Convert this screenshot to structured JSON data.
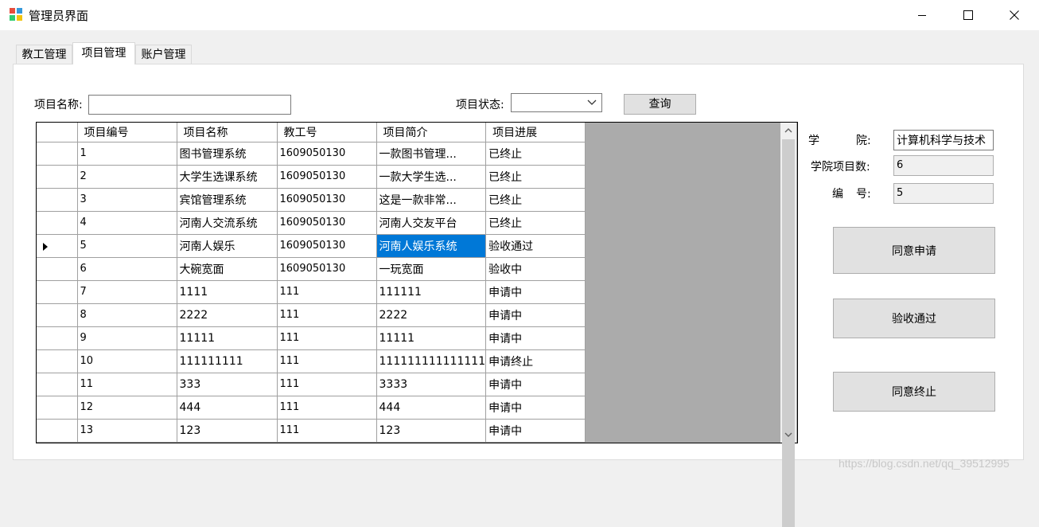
{
  "window": {
    "title": "管理员界面",
    "minimize_icon": "minimize-icon",
    "maximize_icon": "maximize-icon",
    "close_icon": "close-icon"
  },
  "tabs": [
    {
      "label": "教工管理",
      "selected": false
    },
    {
      "label": "项目管理",
      "selected": true
    },
    {
      "label": "账户管理",
      "selected": false
    }
  ],
  "search": {
    "name_label": "项目名称:",
    "name_value": "",
    "status_label": "项目状态:",
    "status_value": "",
    "query_label": "查询"
  },
  "grid": {
    "columns": [
      "项目编号",
      "项目名称",
      "教工号",
      "项目简介",
      "项目进展"
    ],
    "current_row": 5,
    "selected_cell": "项目简介",
    "rows": [
      [
        "1",
        "图书管理系统",
        "1609050130",
        "一款图书管理...",
        "已终止"
      ],
      [
        "2",
        "大学生选课系统",
        "1609050130",
        "一款大学生选...",
        "已终止"
      ],
      [
        "3",
        "宾馆管理系统",
        "1609050130",
        "这是一款非常...",
        "已终止"
      ],
      [
        "4",
        "河南人交流系统",
        "1609050130",
        "河南人交友平台",
        "已终止"
      ],
      [
        "5",
        "河南人娱乐",
        "1609050130",
        "河南人娱乐系统",
        "验收通过"
      ],
      [
        "6",
        "大碗宽面",
        "1609050130",
        "一玩宽面",
        "验收中"
      ],
      [
        "7",
        "1111",
        "111",
        "111111",
        "申请中"
      ],
      [
        "8",
        "2222",
        "111",
        "2222",
        "申请中"
      ],
      [
        "9",
        "11111",
        "111",
        "11111",
        "申请中"
      ],
      [
        "10",
        "111111111",
        "111",
        "111111111111111",
        "申请终止"
      ],
      [
        "11",
        "333",
        "111",
        "3333",
        "申请中"
      ],
      [
        "12",
        "444",
        "111",
        "444",
        "申请中"
      ],
      [
        "13",
        "123",
        "111",
        "123",
        "申请中"
      ]
    ]
  },
  "details": {
    "college_label_a": "学",
    "college_label_b": "院:",
    "college_value": "计算机科学与技术",
    "count_label": "学院项目数:",
    "count_value": "6",
    "number_label_a": "编",
    "number_label_b": "号:",
    "number_value": "5"
  },
  "actions": {
    "approve": "同意申请",
    "accept": "验收通过",
    "terminate": "同意终止"
  },
  "watermark": "https://blog.csdn.net/qq_39512995",
  "colors": {
    "selection": "#0078d7",
    "grid_background": "#ababab"
  }
}
